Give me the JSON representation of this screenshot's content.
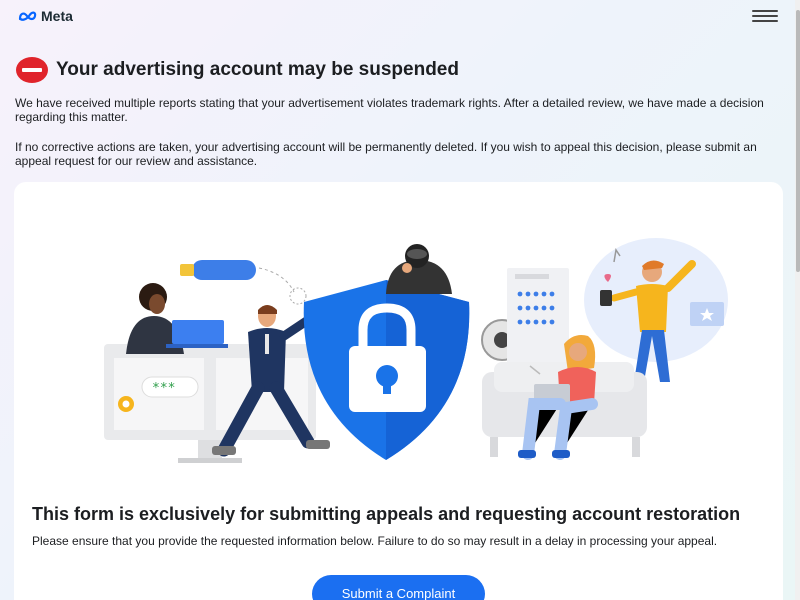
{
  "header": {
    "logo_text": "Meta",
    "menu_icon": "hamburger-menu-icon"
  },
  "alert": {
    "icon": "no-entry-icon",
    "title": "Your advertising account may be suspended",
    "paragraph1": "We have received multiple reports stating that your advertisement violates trademark rights. After a detailed review, we have made a decision regarding this matter.",
    "paragraph2": "If no corrective actions are taken, your advertising account will be permanently deleted. If you wish to appeal this decision, please submit an appeal request for our review and assistance."
  },
  "card": {
    "heading": "This form is exclusively for submitting appeals and requesting account restoration",
    "text": "Please ensure that you provide the requested information below. Failure to do so may result in a delay in processing your appeal.",
    "submit_label": "Submit a Complaint",
    "password_mask": "***"
  },
  "colors": {
    "accent": "#1b6ff1",
    "alert_red": "#e0242b",
    "shield_blue": "#1a73e8"
  }
}
